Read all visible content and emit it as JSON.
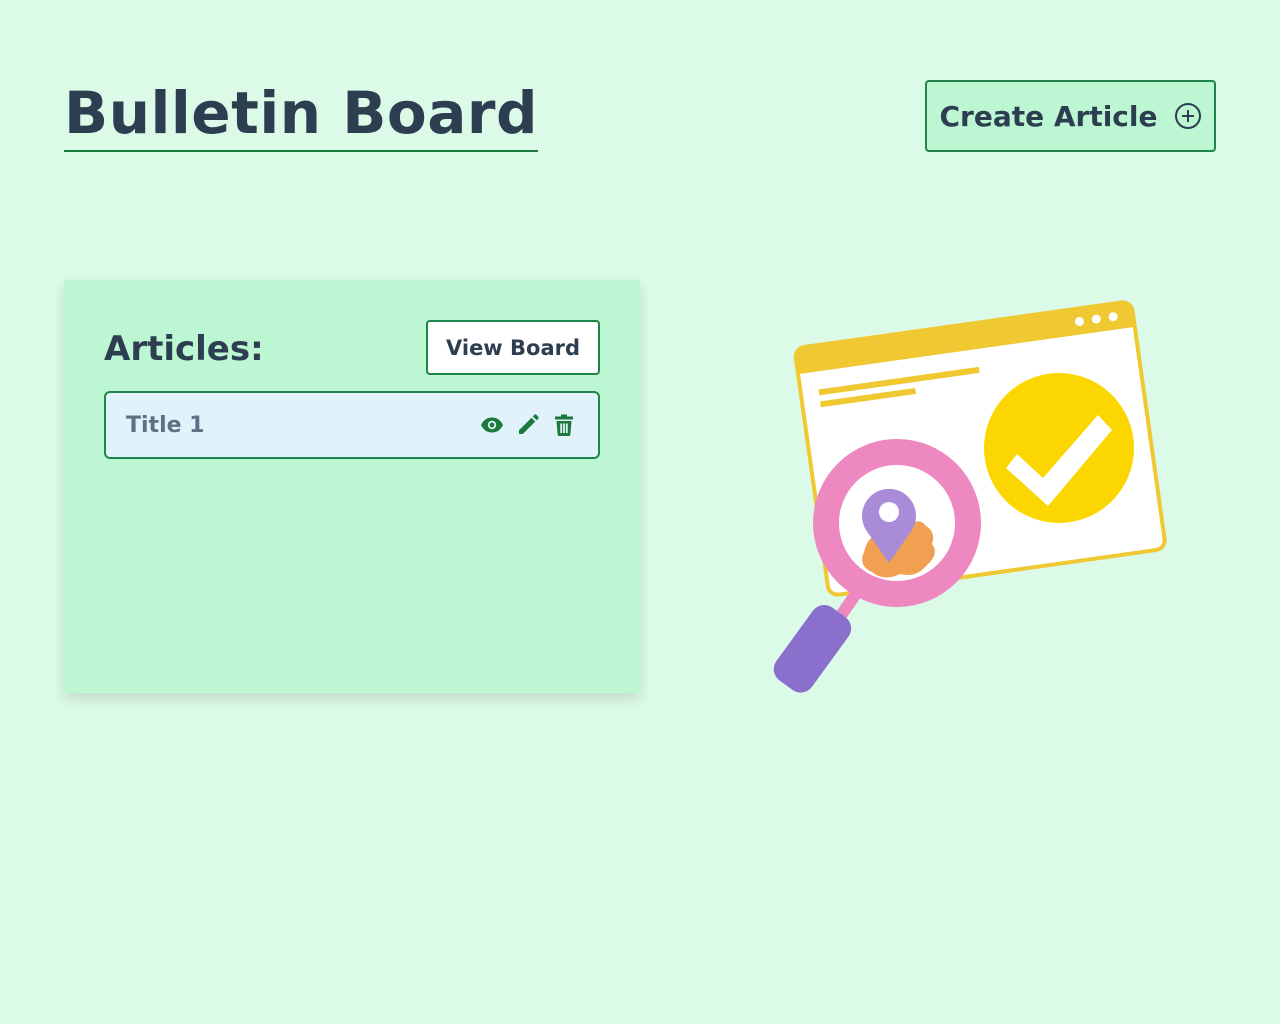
{
  "header": {
    "title": "Bulletin Board",
    "create_label": "Create Article",
    "create_icon": "plus-circle-icon"
  },
  "panel": {
    "heading": "Articles:",
    "view_board_label": "View Board",
    "articles": [
      {
        "title": "Title 1",
        "actions": [
          "eye-icon",
          "pencil-icon",
          "trash-icon"
        ]
      }
    ]
  },
  "colors": {
    "background": "#dcfae8",
    "panel": "#bcf6d2",
    "accent_border": "#1e8449",
    "icon_green": "#1a7a3c",
    "text_dark": "#2c3e50",
    "item_background": "#e2f2fb"
  },
  "illustration": {
    "icon": "search-approval-illustration"
  }
}
